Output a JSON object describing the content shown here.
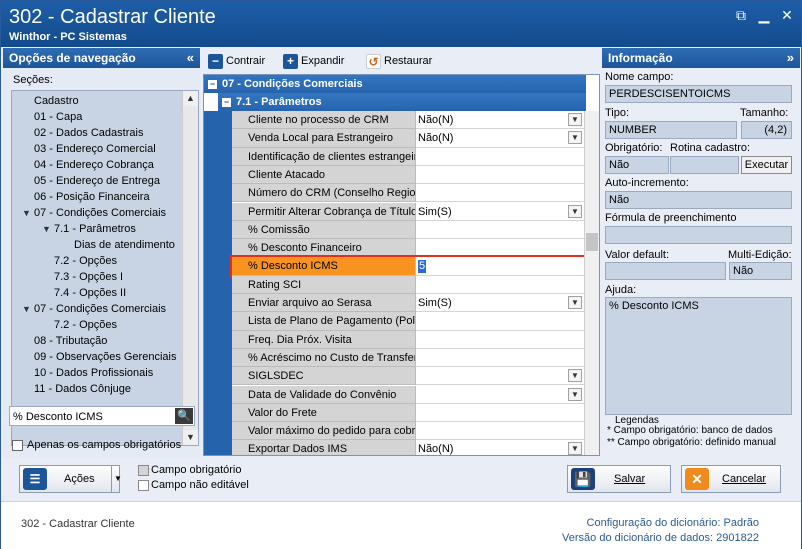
{
  "window": {
    "title": "302 - Cadastrar Cliente",
    "subtitle": "Winthor - PC Sistemas"
  },
  "nav": {
    "header": "Opções de navegação",
    "sections_label": "Seções:",
    "items": [
      {
        "label": "Cadastro",
        "indent": 0,
        "toggle": ""
      },
      {
        "label": "01 - Capa",
        "indent": 1,
        "toggle": ""
      },
      {
        "label": "02 - Dados Cadastrais",
        "indent": 1,
        "toggle": ""
      },
      {
        "label": "03 - Endereço Comercial",
        "indent": 1,
        "toggle": ""
      },
      {
        "label": "04 - Endereço Cobrança",
        "indent": 1,
        "toggle": ""
      },
      {
        "label": "05 - Endereço de Entrega",
        "indent": 1,
        "toggle": ""
      },
      {
        "label": "06 - Posição Financeira",
        "indent": 1,
        "toggle": ""
      },
      {
        "label": "07 - Condições Comerciais",
        "indent": 1,
        "toggle": "▼"
      },
      {
        "label": "7.1 - Parâmetros",
        "indent": 2,
        "toggle": "▼"
      },
      {
        "label": "Dias de atendimento",
        "indent": 3,
        "toggle": ""
      },
      {
        "label": "7.2 - Opções",
        "indent": 2,
        "toggle": ""
      },
      {
        "label": "7.3 - Opções I",
        "indent": 2,
        "toggle": ""
      },
      {
        "label": "7.4 - Opções II",
        "indent": 2,
        "toggle": ""
      },
      {
        "label": "07 - Condições Comerciais",
        "indent": 1,
        "toggle": "▼"
      },
      {
        "label": "7.2 - Opções",
        "indent": 2,
        "toggle": ""
      },
      {
        "label": "08 - Tributação",
        "indent": 1,
        "toggle": ""
      },
      {
        "label": "09 - Observações Gerenciais",
        "indent": 1,
        "toggle": ""
      },
      {
        "label": "10 - Dados Profissionais",
        "indent": 1,
        "toggle": ""
      },
      {
        "label": "11 - Dados Cônjuge",
        "indent": 1,
        "toggle": ""
      }
    ],
    "search_value": "% Desconto ICMS",
    "only_required_label": "Apenas os campos obrigatórios"
  },
  "toolbar": {
    "collapse_label": "Contrair",
    "expand_label": "Expandir",
    "restore_label": "Restaurar"
  },
  "grid": {
    "section_title": "07 - Condições Comerciais",
    "subsection_title": "7.1 - Parâmetros",
    "rows": [
      {
        "label": "Cliente no processo de CRM",
        "value": "Não(N)",
        "dropdown": true
      },
      {
        "label": "Venda Local para Estrangeiro",
        "value": "Não(N)",
        "dropdown": true
      },
      {
        "label": "Identificação de clientes estrangeiros",
        "value": "",
        "dropdown": false
      },
      {
        "label": "Cliente Atacado",
        "value": "",
        "dropdown": false
      },
      {
        "label": "Número do CRM (Conselho Regional)",
        "value": "",
        "dropdown": false
      },
      {
        "label": "Permitir Alterar Cobrança de Título",
        "value": "Sim(S)",
        "dropdown": true
      },
      {
        "label": "% Comissão",
        "value": "",
        "dropdown": false
      },
      {
        "label": "% Desconto Financeiro",
        "value": "",
        "dropdown": false
      },
      {
        "label": "% Desconto ICMS",
        "value": "5",
        "dropdown": false,
        "selected": true
      },
      {
        "label": "Rating SCI",
        "value": "",
        "dropdown": false
      },
      {
        "label": "Enviar arquivo ao Serasa",
        "value": "Sim(S)",
        "dropdown": true
      },
      {
        "label": "Lista de Plano de Pagamento (Políticas)",
        "value": "",
        "dropdown": false
      },
      {
        "label": "Freq. Dia Próx. Visita",
        "value": "",
        "dropdown": false
      },
      {
        "label": "% Acréscimo no Custo de Transferência",
        "value": "",
        "dropdown": false
      },
      {
        "label": "SIGLSDEC",
        "value": "",
        "dropdown": true
      },
      {
        "label": "Data de Validade do Convênio",
        "value": "",
        "dropdown": true
      },
      {
        "label": "Valor do Frete",
        "value": "",
        "dropdown": false
      },
      {
        "label": "Valor máximo do pedido para cobrança",
        "value": "",
        "dropdown": false
      },
      {
        "label": "Exportar Dados IMS",
        "value": "Não(N)",
        "dropdown": true
      }
    ]
  },
  "info": {
    "header": "Informação",
    "field_name_label": "Nome campo:",
    "field_name_value": "PERDESCISENTOICMS",
    "type_label": "Tipo:",
    "type_value": "NUMBER",
    "size_label": "Tamanho:",
    "size_value": "(4,2)",
    "required_label": "Obrigatório:",
    "required_value": "Não",
    "routine_label": "Rotina cadastro:",
    "execute_label": "Executar",
    "autoinc_label": "Auto-incremento:",
    "autoinc_value": "Não",
    "formula_label": "Fórmula de preenchimento",
    "default_label": "Valor default:",
    "multi_label": "Multi-Edição:",
    "multi_value": "Não",
    "help_label": "Ajuda:",
    "help_value": "% Desconto ICMS",
    "legend_title": "Legendas",
    "legend_1": "* Campo obrigatório: banco de dados",
    "legend_2": "** Campo obrigatório: definido manual"
  },
  "bottom": {
    "actions_label": "Ações",
    "required_field_label": "Campo obrigatório",
    "not_editable_label": "Campo não editável",
    "save_label": "Salvar",
    "cancel_label": "Cancelar"
  },
  "status": {
    "left": "302 - Cadastrar Cliente",
    "config_label": "Configuração do dicionário:",
    "config_value": "Padrão",
    "version_label": "Versão do dicionário de dados:",
    "version_value": "2901822"
  },
  "colors": {
    "title_bar": "#1d5ea8",
    "section_blue": "#2663ad",
    "selected_row": "#f7931e",
    "selected_border": "#e03020"
  }
}
